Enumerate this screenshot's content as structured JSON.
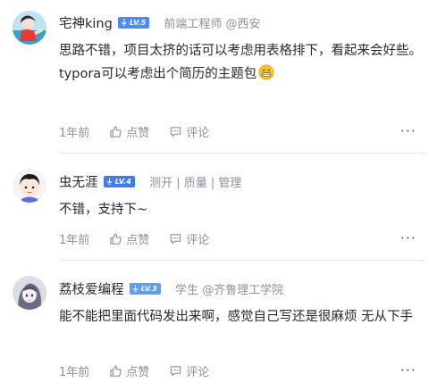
{
  "comments": [
    {
      "author": "宅神king",
      "level": "LV.5",
      "meta": "前端工程师 @西安",
      "lines": [
        "思路不错，项目太挤的话可以考虑用表格排下，看起来会好些。",
        "typora可以考虑出个简历的主题包"
      ],
      "time": "1年前",
      "like_label": "点赞",
      "comment_label": "评论",
      "more_icon": "more-dots-icon"
    },
    {
      "author": "虫无涯",
      "level": "LV.4",
      "meta": "测开 | 质量 | 管理",
      "lines": [
        "不错，支持下~"
      ],
      "time": "1年前",
      "like_label": "点赞",
      "comment_label": "评论",
      "more_icon": "more-dots-icon"
    },
    {
      "author": "荔枝爱编程",
      "level": "LV.3",
      "meta": "学生 @齐鲁理工学院",
      "lines": [
        "能不能把里面代码发出来啊，感觉自己写还是很麻烦 无从下手"
      ],
      "time": "1年前",
      "like_label": "点赞",
      "comment_label": "评论",
      "more_icon": "more-dots-icon"
    }
  ],
  "colors": {
    "text_primary": "#252933",
    "text_secondary": "#8a919f",
    "level_badge": "#4a8cf7",
    "divider": "#e4e6eb"
  }
}
